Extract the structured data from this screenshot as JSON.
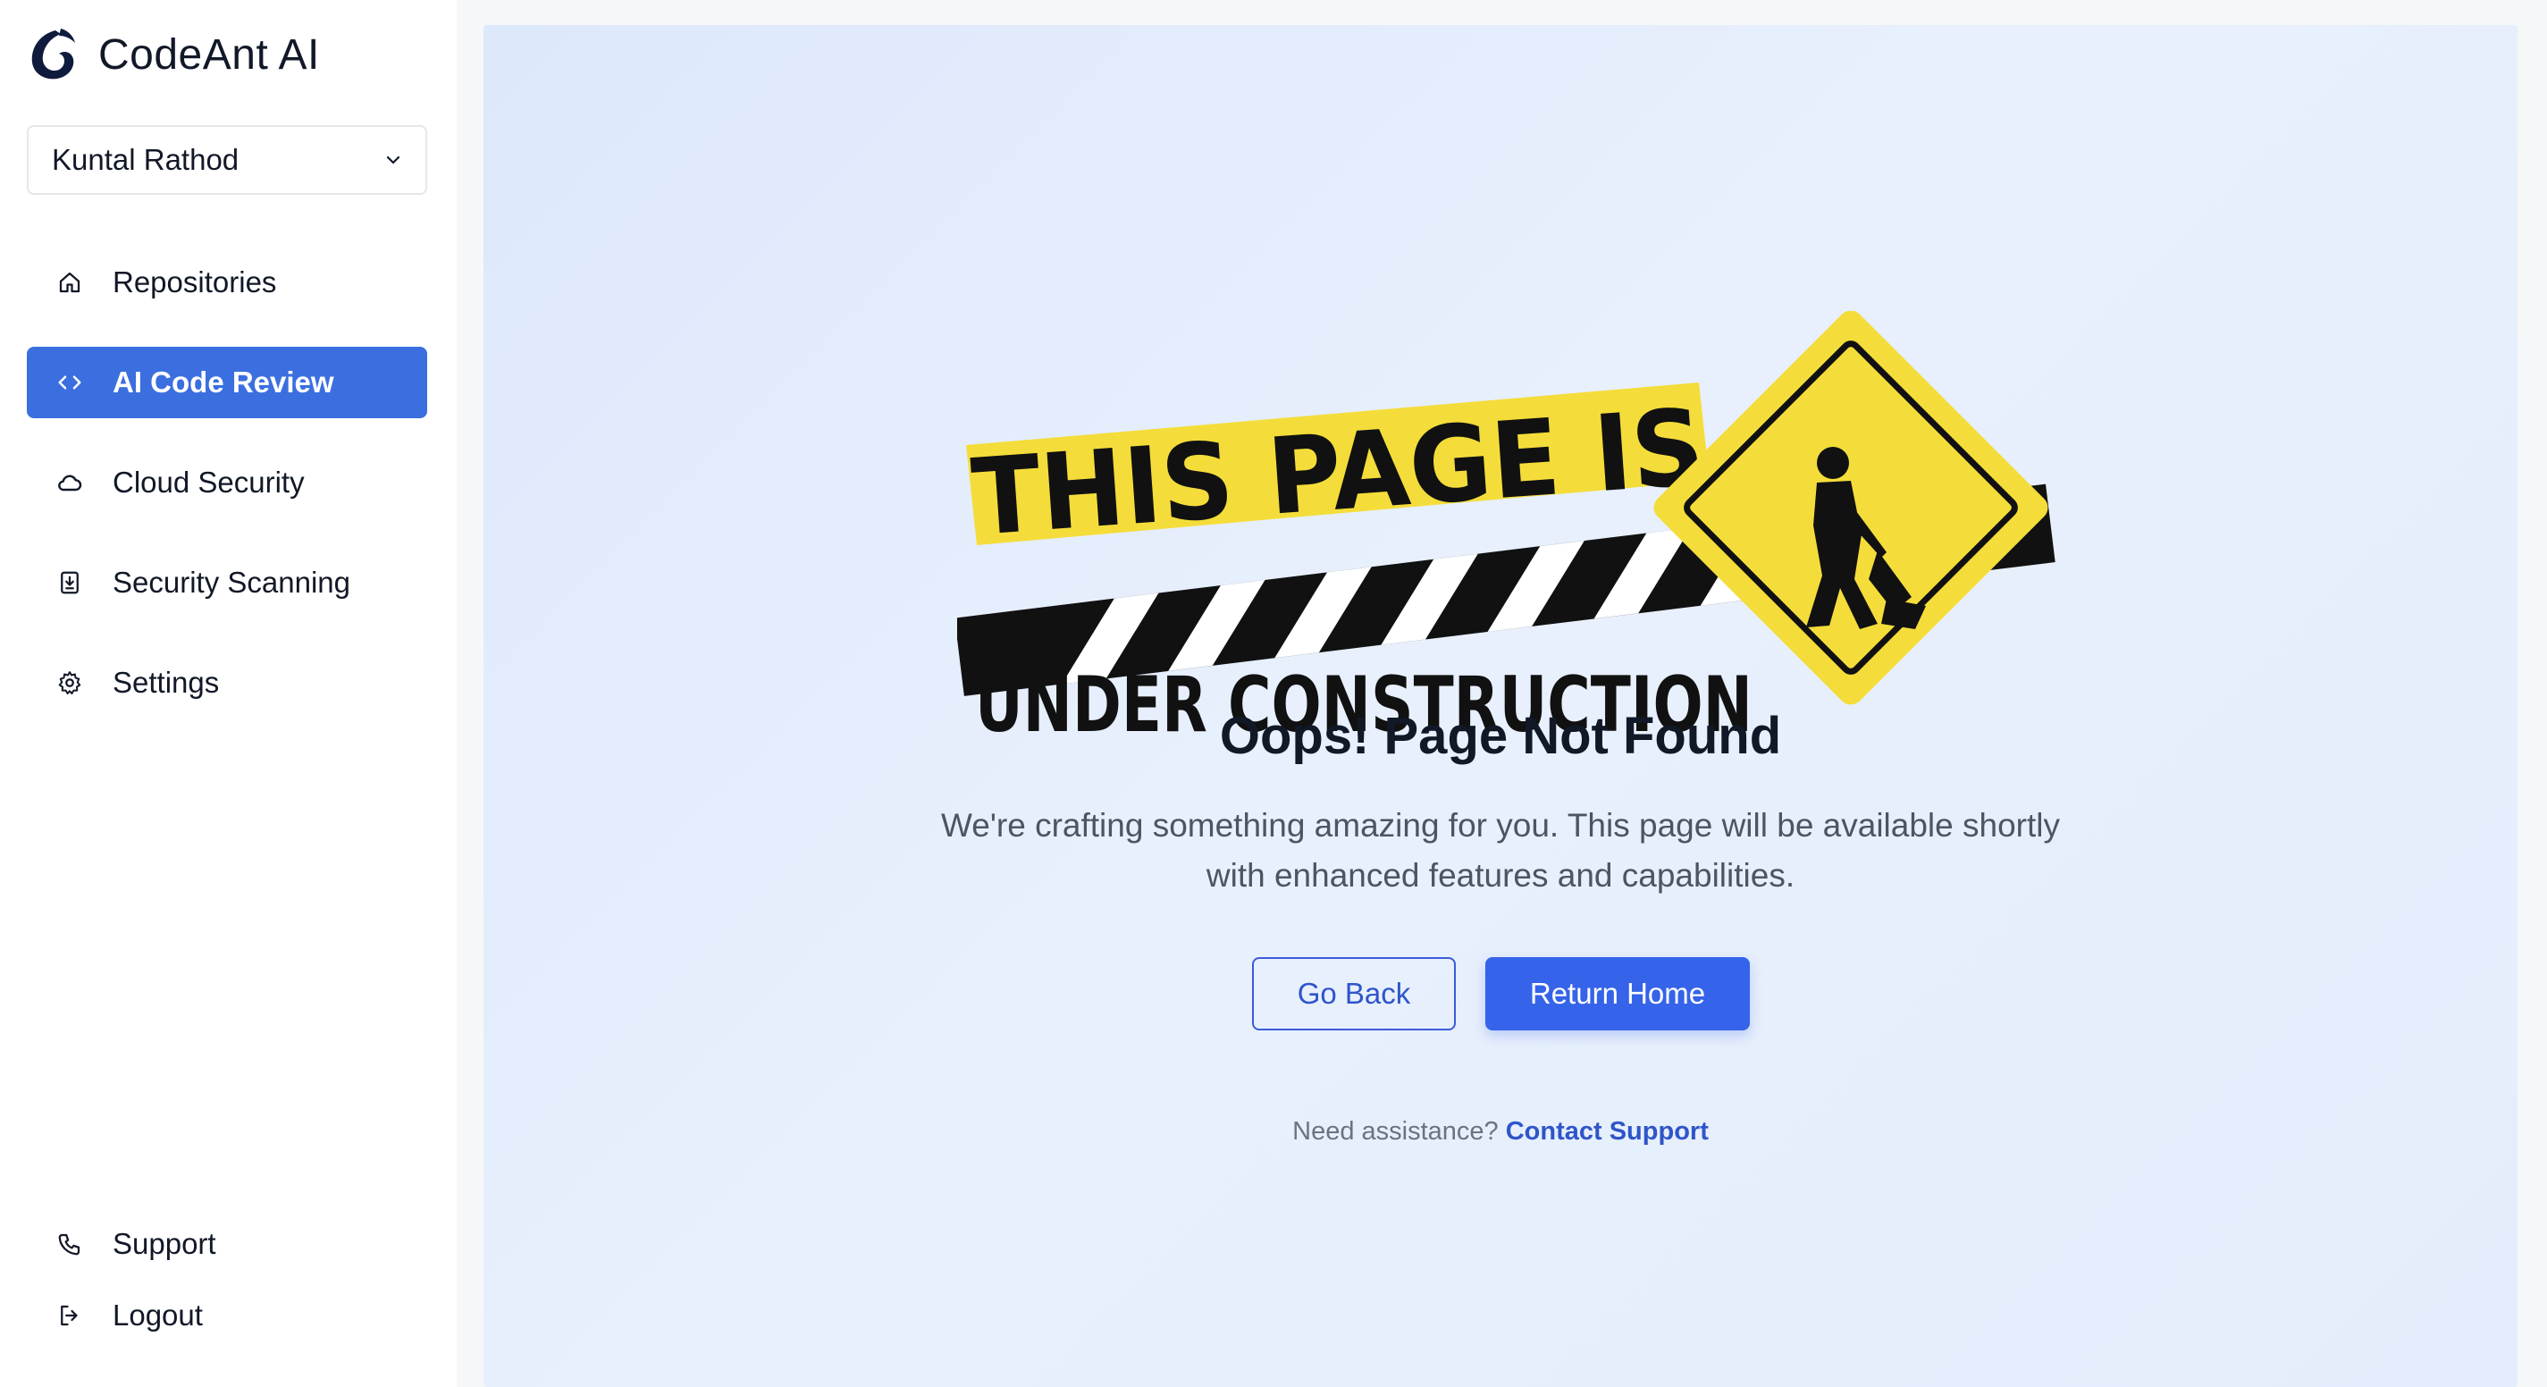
{
  "brand": {
    "name": "CodeAnt AI",
    "logo_icon": "codeant-logo-icon"
  },
  "org_selector": {
    "value": "Kuntal Rathod",
    "icon": "chevron-down-icon"
  },
  "sidebar": {
    "items": [
      {
        "label": "Repositories",
        "icon": "home-icon",
        "active": false
      },
      {
        "label": "AI Code Review",
        "icon": "code-icon",
        "active": true
      },
      {
        "label": "Cloud Security",
        "icon": "cloud-icon",
        "active": false
      },
      {
        "label": "Security Scanning",
        "icon": "download-file-icon",
        "active": false
      },
      {
        "label": "Settings",
        "icon": "gear-icon",
        "active": false
      }
    ],
    "bottom_items": [
      {
        "label": "Support",
        "icon": "phone-icon"
      },
      {
        "label": "Logout",
        "icon": "logout-icon"
      }
    ]
  },
  "illustration": {
    "line1": "THIS PAGE IS",
    "line2": "UNDER CONSTRUCTION",
    "colors": {
      "yellow": "#f4dd3a",
      "black": "#111111"
    }
  },
  "main": {
    "title": "Oops! Page Not Found",
    "description_line1": "We're crafting something amazing for you. This page will be available shortly",
    "description_line2": "with enhanced features and capabilities.",
    "go_back_label": "Go Back",
    "return_home_label": "Return Home",
    "help_text": "Need assistance?",
    "help_link": "Contact Support"
  },
  "colors": {
    "accent": "#3b6fe0",
    "primary_button": "#3563e9",
    "link": "#2f55c9"
  }
}
